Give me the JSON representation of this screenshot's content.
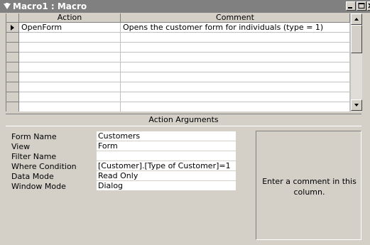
{
  "window": {
    "title": "Macro1 : Macro"
  },
  "grid": {
    "columns": [
      "Action",
      "Comment"
    ],
    "rows": [
      {
        "action": "OpenForm",
        "comment": "Opens the customer form for individuals (type = 1)"
      }
    ]
  },
  "arguments": {
    "header": "Action Arguments",
    "fields": [
      {
        "label": "Form Name",
        "value": "Customers"
      },
      {
        "label": "View",
        "value": "Form"
      },
      {
        "label": "Filter Name",
        "value": ""
      },
      {
        "label": "Where Condition",
        "value": "[Customer].[Type of Customer]=1"
      },
      {
        "label": "Data Mode",
        "value": "Read Only"
      },
      {
        "label": "Window Mode",
        "value": "Dialog"
      }
    ],
    "comment_hint": "Enter a comment in this column."
  }
}
